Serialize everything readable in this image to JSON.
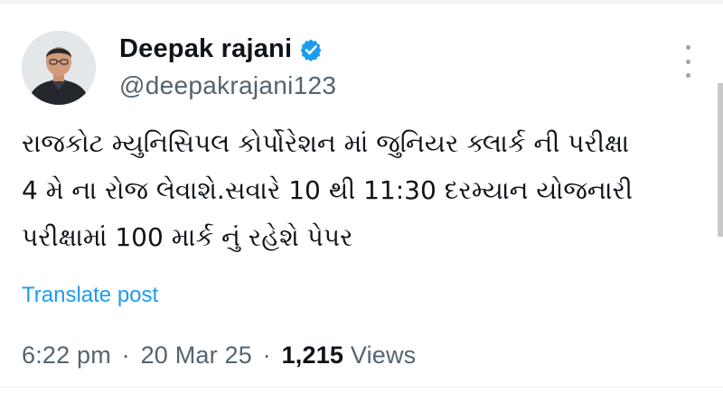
{
  "author": {
    "display_name": "Deepak rajani",
    "handle": "@deepakrajani123",
    "verified": true
  },
  "tweet": {
    "lines": [
      "રાજકોટ મ્યુનિસિપલ કોર્પોરેશન માં જુનિયર ક્લાર્ક ની પરીક્ષા",
      "4 મે ના રોજ લેવાશે.સવારે 10 થી 11:30 દરમ્યાન યોજનારી",
      "પરીક્ષામાં 100 માર્ક નું રહેશે પેપર"
    ],
    "translate_label": "Translate post"
  },
  "meta": {
    "time": "6:22 pm",
    "separator": "·",
    "date": "20 Mar 25",
    "views_count": "1,215",
    "views_label": "Views"
  },
  "icons": {
    "verified": "verified-badge-icon",
    "more": "more-options-icon"
  },
  "colors": {
    "accent": "#1d9bf0",
    "text_primary": "#0f1419",
    "text_secondary": "#536471"
  }
}
